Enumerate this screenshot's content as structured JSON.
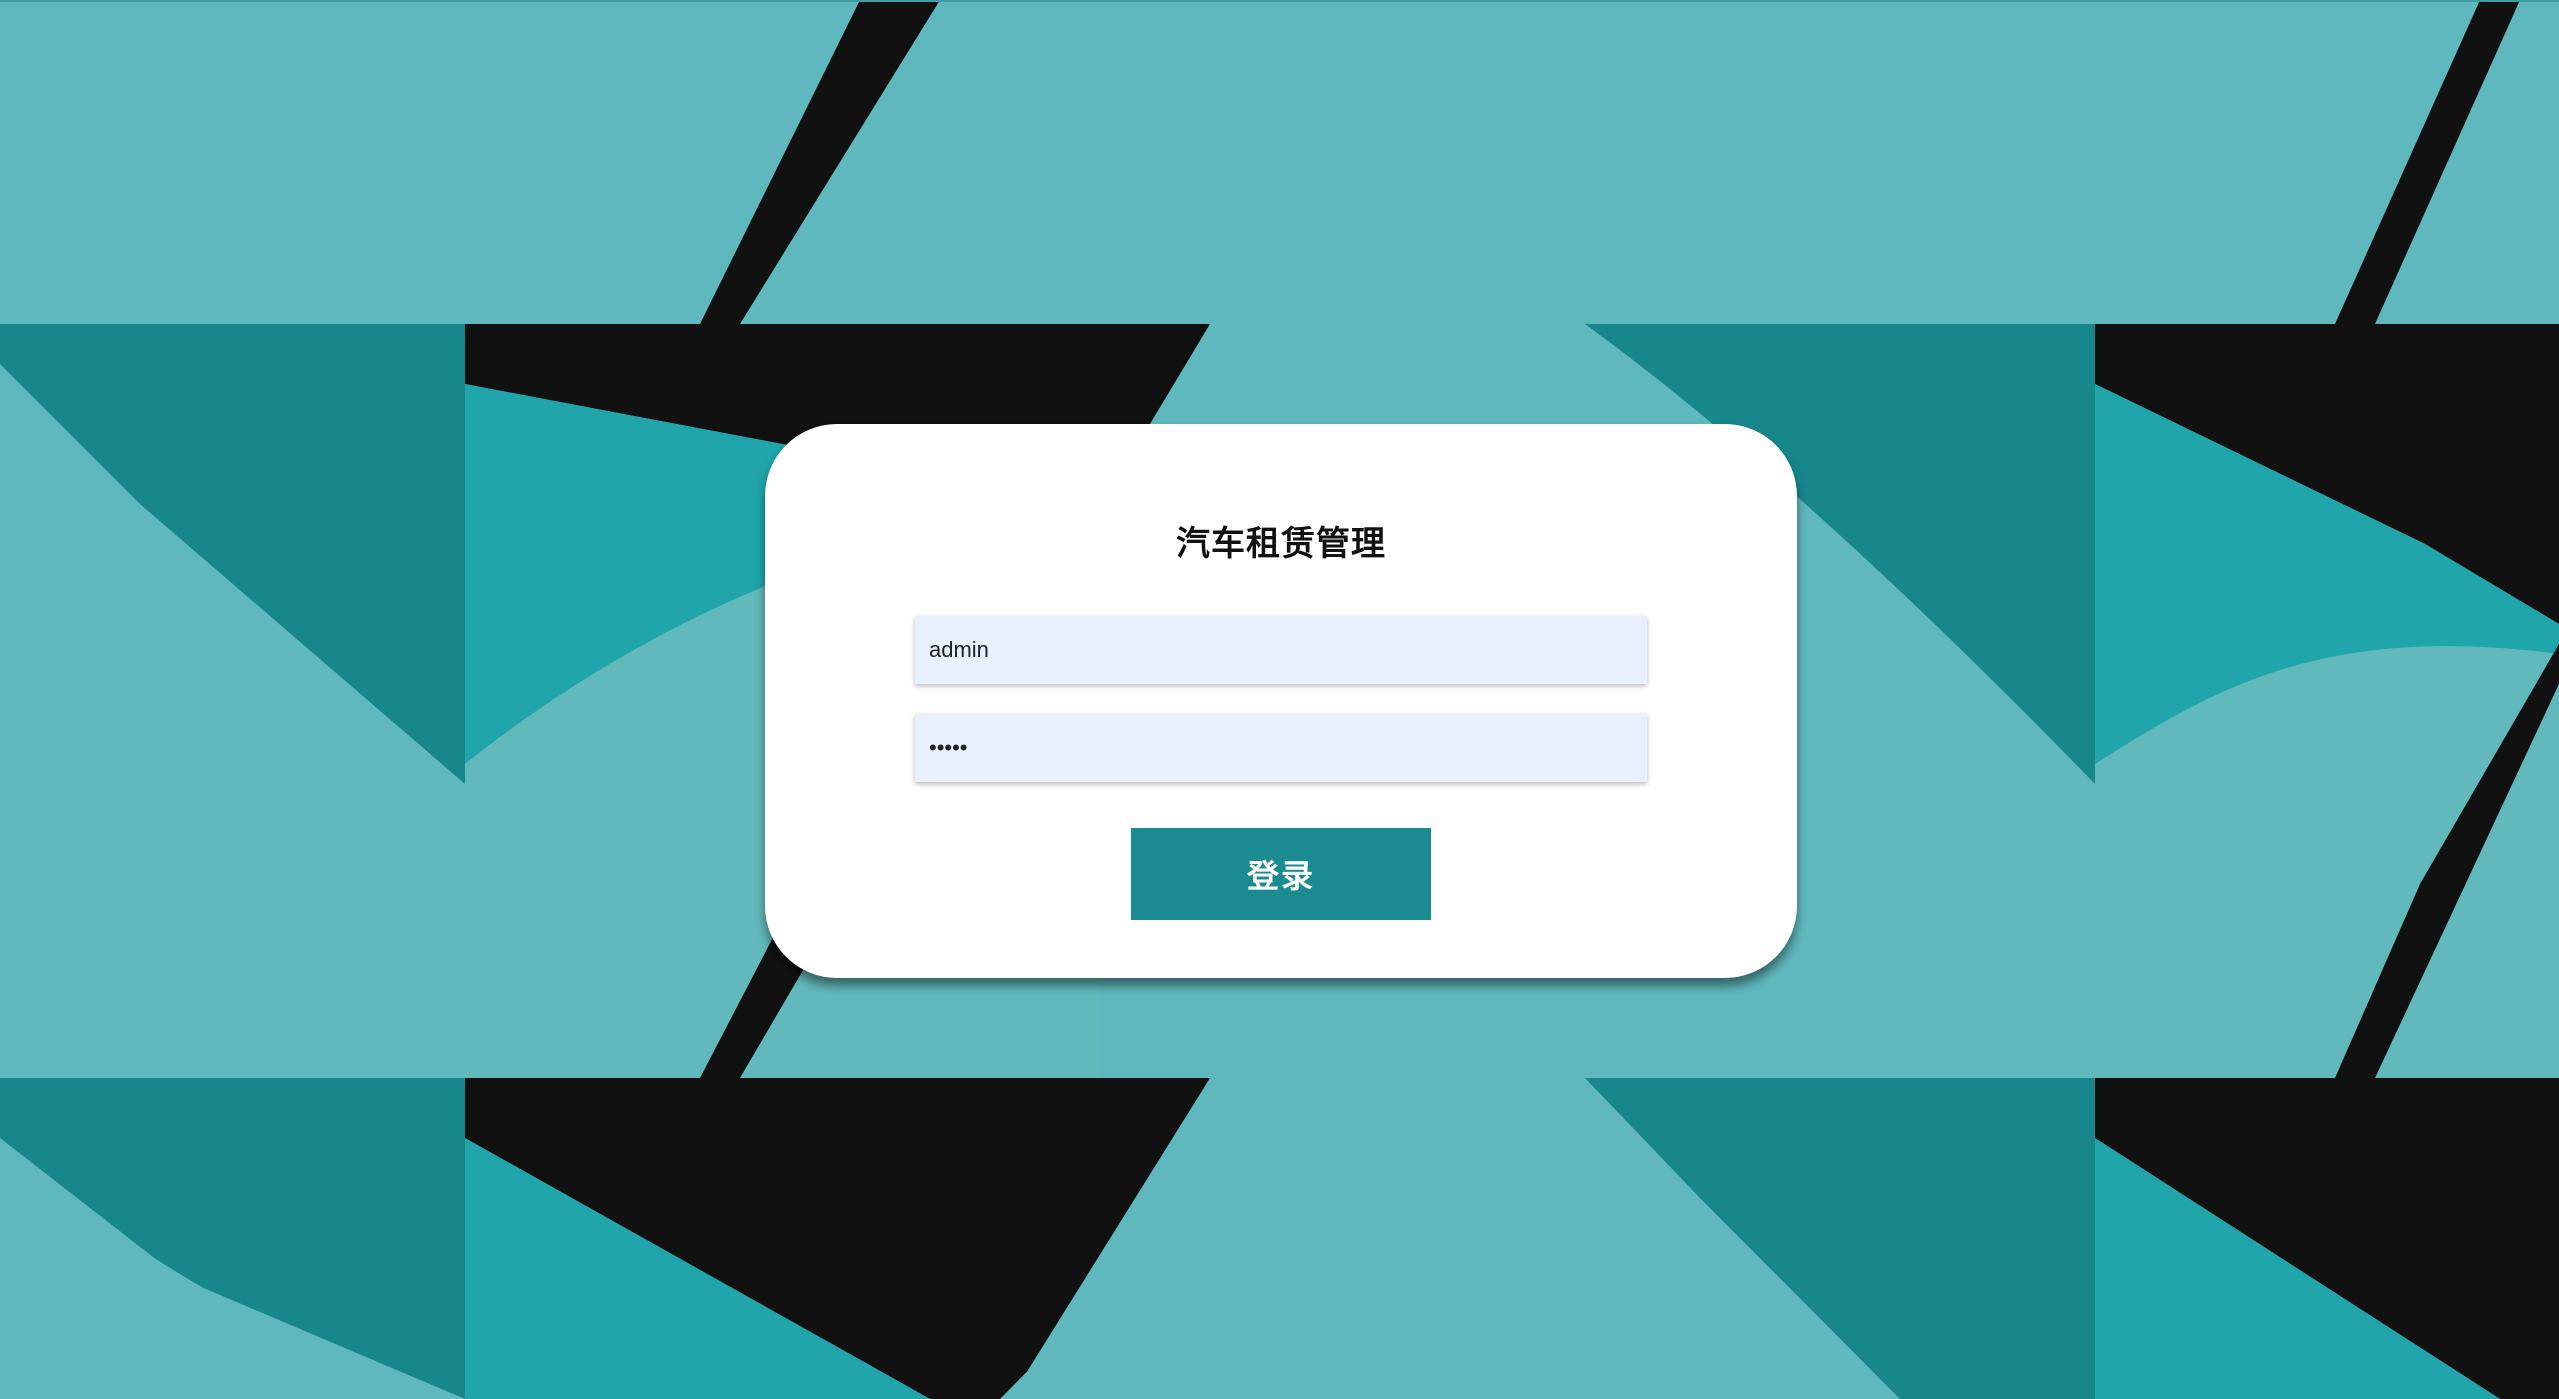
{
  "login": {
    "title": "汽车租赁管理",
    "username_value": "admin",
    "password_value": "admin",
    "button_label": "登录"
  },
  "colors": {
    "accent": "#1a8b91",
    "input_bg": "#e8f0fe",
    "bg_teal_light": "#5fb8bd",
    "bg_teal_dark": "#17878c",
    "bg_black": "#111111"
  }
}
